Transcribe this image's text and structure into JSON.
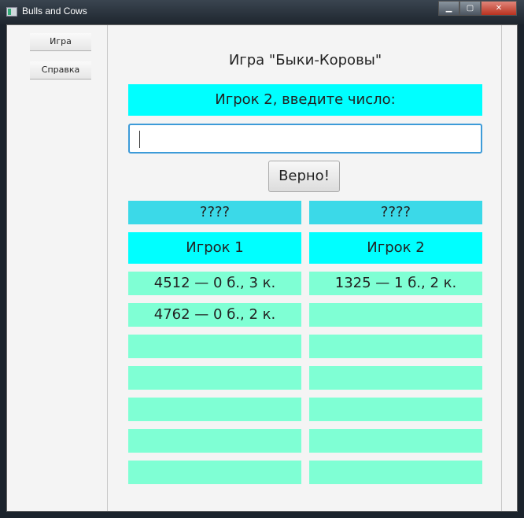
{
  "window": {
    "title": "Bulls and Cows"
  },
  "sidebar": {
    "items": [
      {
        "label": "Игра"
      },
      {
        "label": "Справка"
      }
    ]
  },
  "main": {
    "title": "Игра \"Быки-Коровы\"",
    "prompt": "Игрок 2, введите число:",
    "input_value": "",
    "submit_label": "Верно!",
    "secrets": [
      "????",
      "????"
    ],
    "players": [
      "Игрок 1",
      "Игрок 2"
    ],
    "rows": [
      [
        "4512 — 0 б., 3 к.",
        "1325 — 1 б., 2 к."
      ],
      [
        "4762 — 0 б., 2 к.",
        ""
      ],
      [
        "",
        ""
      ],
      [
        "",
        ""
      ],
      [
        "",
        ""
      ],
      [
        "",
        ""
      ],
      [
        "",
        ""
      ]
    ]
  },
  "colors": {
    "prompt": "#00ffff",
    "secret": "#3bd9e8",
    "row": "#7fffd4"
  }
}
